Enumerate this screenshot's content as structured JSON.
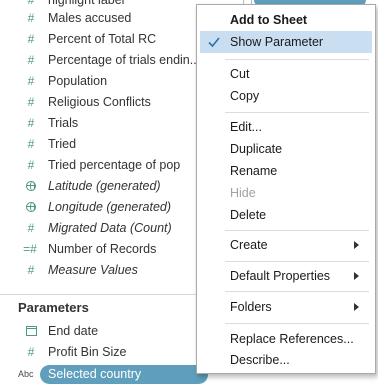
{
  "data_pane": {
    "top_partial_label": "highlight label",
    "fields": [
      {
        "icon": "hash",
        "label": "Males accused",
        "italic": false
      },
      {
        "icon": "hash",
        "label": "Percent of Total RC",
        "italic": false
      },
      {
        "icon": "hash",
        "label": "Percentage of trials endin...",
        "italic": false
      },
      {
        "icon": "hash",
        "label": "Population",
        "italic": false
      },
      {
        "icon": "hash",
        "label": "Religious Conflicts",
        "italic": false
      },
      {
        "icon": "hash",
        "label": "Trials",
        "italic": false
      },
      {
        "icon": "hash",
        "label": "Tried",
        "italic": false
      },
      {
        "icon": "hash",
        "label": "Tried percentage of pop",
        "italic": false
      },
      {
        "icon": "globe",
        "label": "Latitude (generated)",
        "italic": true
      },
      {
        "icon": "globe",
        "label": "Longitude (generated)",
        "italic": true
      },
      {
        "icon": "hash",
        "label": "Migrated Data (Count)",
        "italic": true
      },
      {
        "icon": "hash-eq",
        "label": "Number of Records",
        "italic": false
      },
      {
        "icon": "hash",
        "label": "Measure Values",
        "italic": true
      }
    ],
    "parameters_title": "Parameters",
    "parameters": [
      {
        "icon": "calendar",
        "label": "End date"
      },
      {
        "icon": "hash",
        "label": "Profit Bin Size"
      }
    ],
    "selected_parameter": {
      "type_label": "Abc",
      "label": "Selected country"
    },
    "background_pill_text": "Selected count..."
  },
  "menu": {
    "items": [
      {
        "label": "Add to Sheet",
        "bold": true
      },
      {
        "label": "Show Parameter",
        "checked": true,
        "highlight": true
      },
      {
        "label": "Cut"
      },
      {
        "label": "Copy"
      },
      {
        "label": "Edit..."
      },
      {
        "label": "Duplicate"
      },
      {
        "label": "Rename"
      },
      {
        "label": "Hide",
        "disabled": true
      },
      {
        "label": "Delete"
      },
      {
        "label": "Create",
        "submenu": true
      },
      {
        "label": "Default Properties",
        "submenu": true
      },
      {
        "label": "Folders",
        "submenu": true
      },
      {
        "label": "Replace References..."
      },
      {
        "label": "Describe..."
      }
    ]
  },
  "colors": {
    "field_icon": "#4e9a7a",
    "selected_pill": "#5f9fbd",
    "menu_highlight": "#c9def1",
    "check": "#2f6fb5"
  }
}
